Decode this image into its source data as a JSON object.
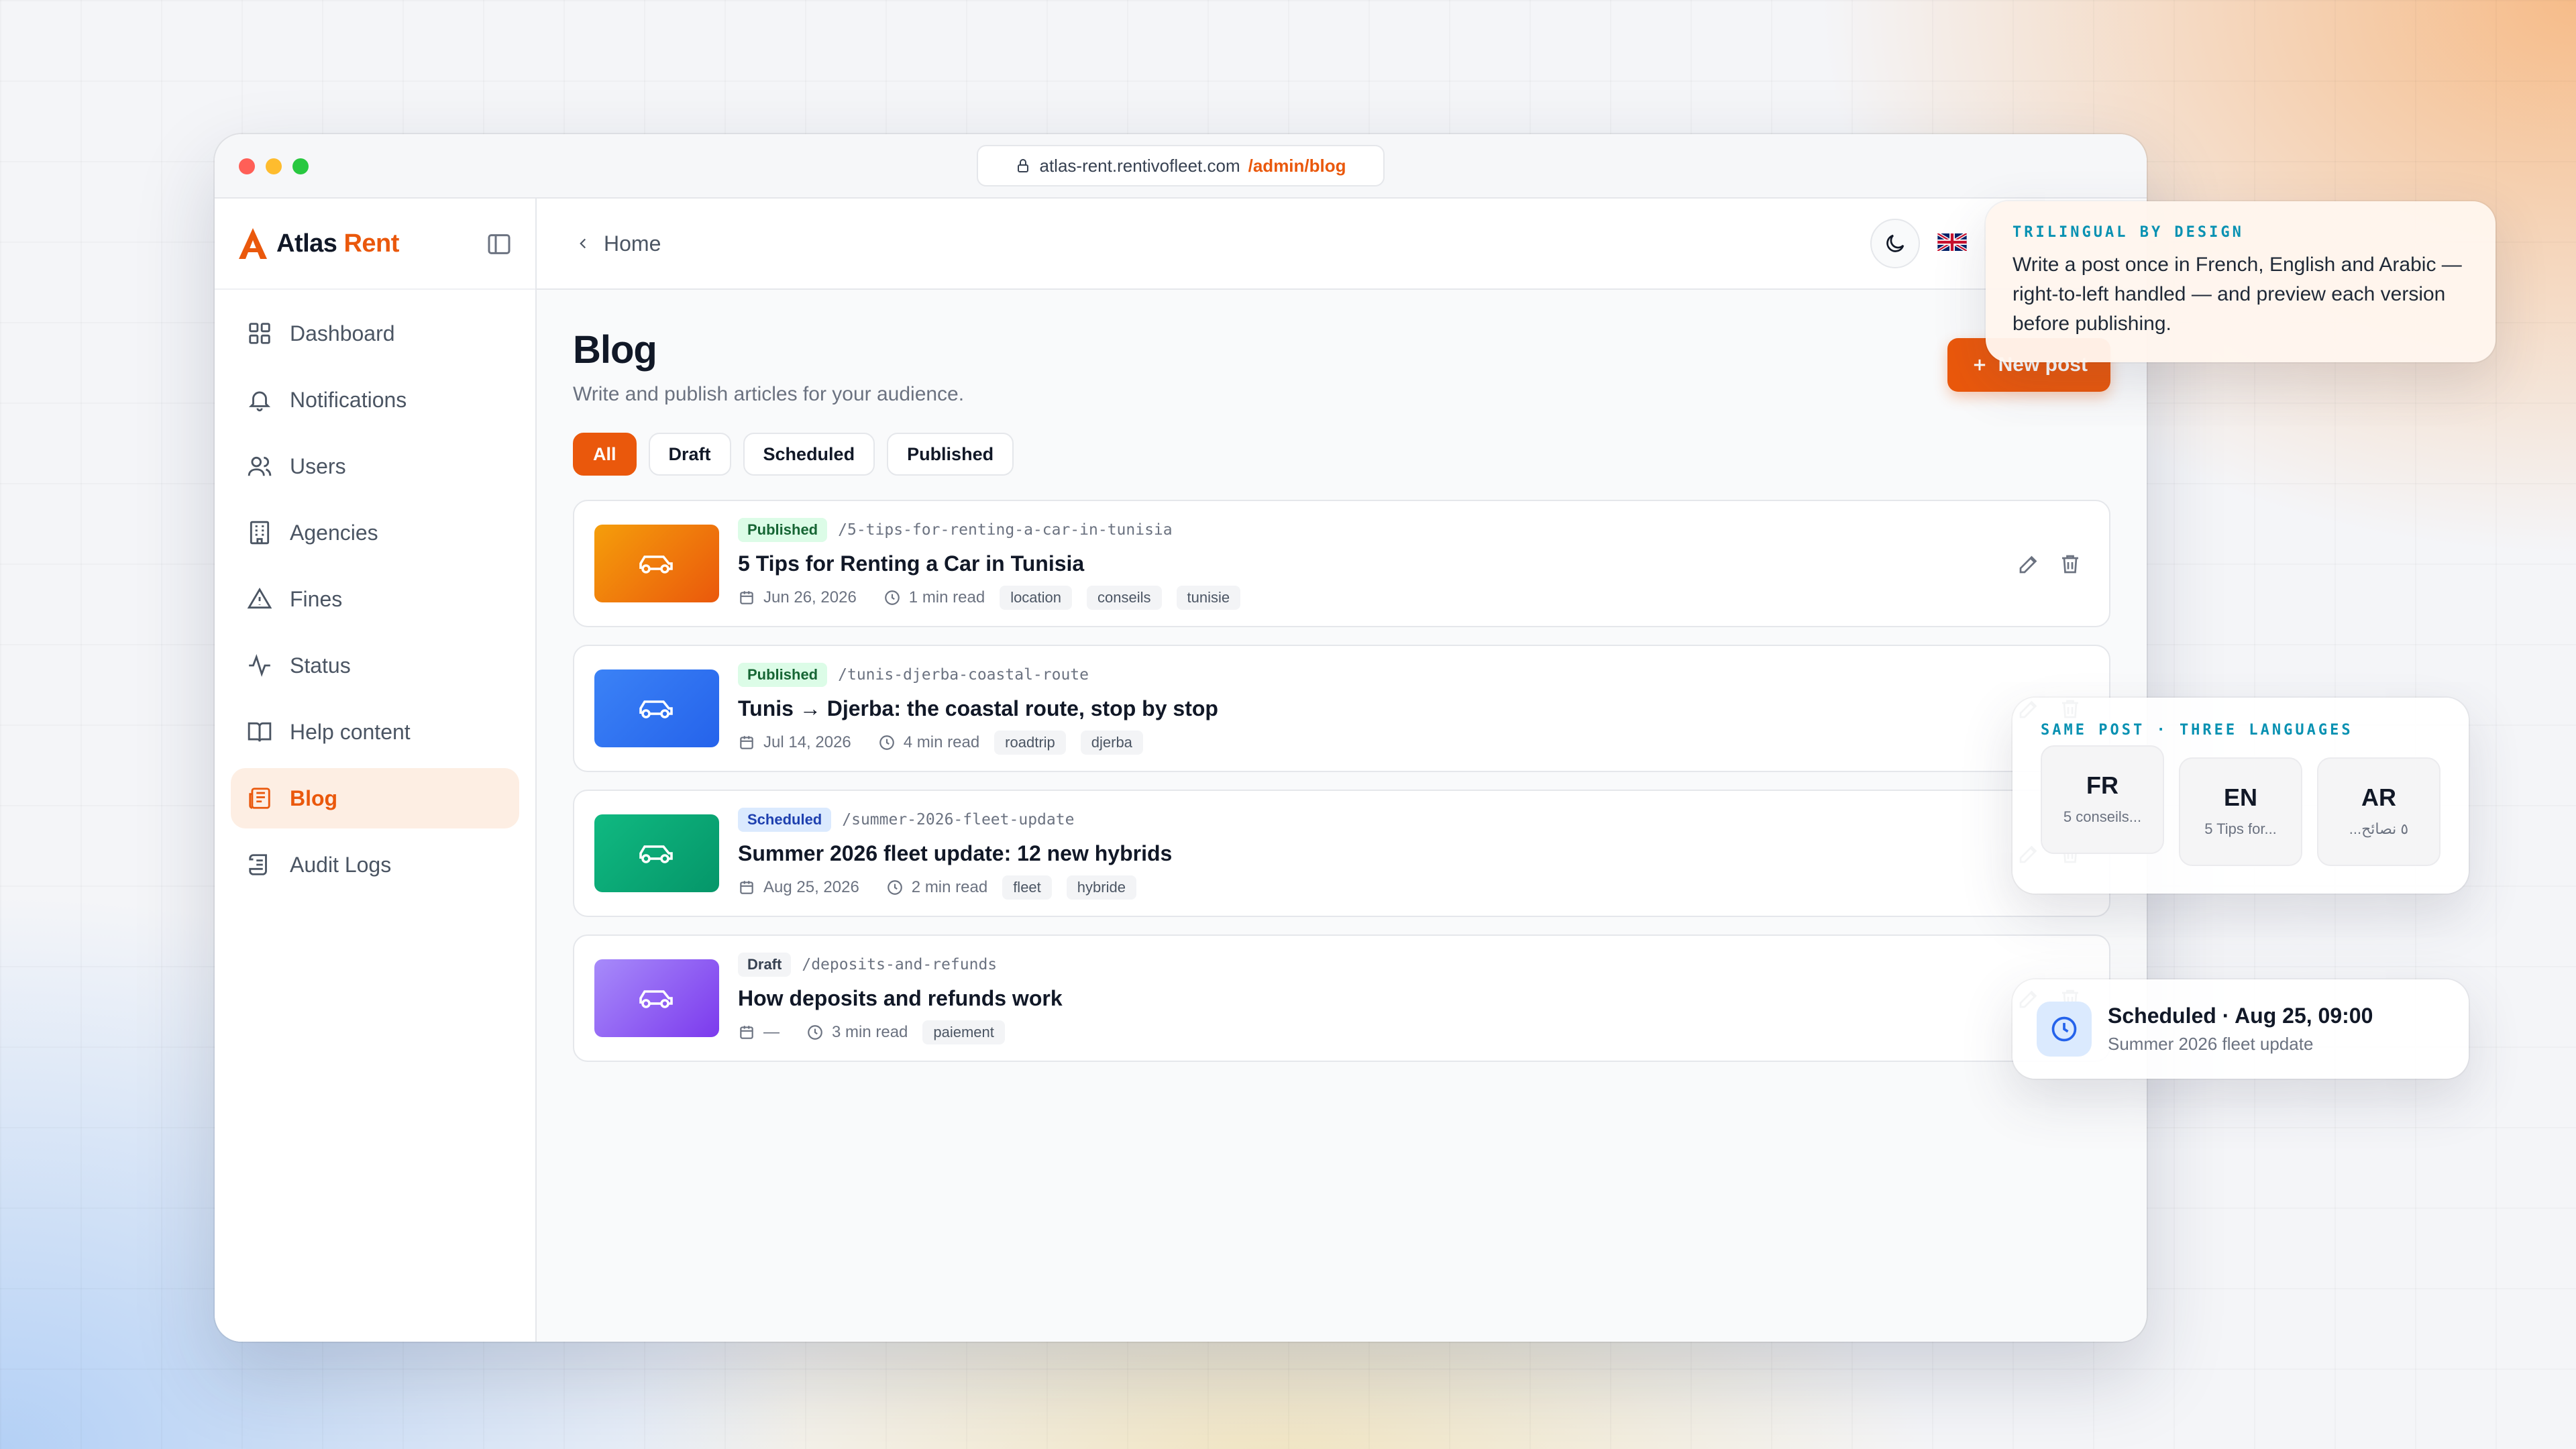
{
  "browser": {
    "url_host": "atlas-rent.rentivofleet.com",
    "url_path": "/admin/blog"
  },
  "brand": {
    "name_first": "Atlas",
    "name_second": "Rent",
    "accent": "#ea580c"
  },
  "sidebar": {
    "items": [
      {
        "label": "Dashboard",
        "icon": "grid-icon"
      },
      {
        "label": "Notifications",
        "icon": "bell-icon"
      },
      {
        "label": "Users",
        "icon": "users-icon"
      },
      {
        "label": "Agencies",
        "icon": "building-icon"
      },
      {
        "label": "Fines",
        "icon": "warning-icon"
      },
      {
        "label": "Status",
        "icon": "activity-icon"
      },
      {
        "label": "Help content",
        "icon": "book-icon"
      },
      {
        "label": "Blog",
        "icon": "newspaper-icon",
        "active": true
      },
      {
        "label": "Audit Logs",
        "icon": "scroll-icon"
      }
    ]
  },
  "topbar": {
    "breadcrumb": "Home"
  },
  "page": {
    "title": "Blog",
    "subtitle": "Write and publish articles for your audience.",
    "new_post_label": "New post",
    "filters": [
      "All",
      "Draft",
      "Scheduled",
      "Published"
    ],
    "active_filter": "All"
  },
  "posts": [
    {
      "status": "Published",
      "slug": "/5-tips-for-renting-a-car-in-tunisia",
      "title": "5 Tips for Renting a Car in Tunisia",
      "date": "Jun 26, 2026",
      "read_time": "1 min read",
      "tags": [
        "location",
        "conseils",
        "tunisie"
      ],
      "thumb_color": "#f97316"
    },
    {
      "status": "Published",
      "slug": "/tunis-djerba-coastal-route",
      "title": "Tunis → Djerba: the coastal route, stop by stop",
      "date": "Jul 14, 2026",
      "read_time": "4 min read",
      "tags": [
        "roadtrip",
        "djerba"
      ],
      "thumb_color": "#3b82f6"
    },
    {
      "status": "Scheduled",
      "slug": "/summer-2026-fleet-update",
      "title": "Summer 2026 fleet update: 12 new hybrids",
      "date": "Aug 25, 2026",
      "read_time": "2 min read",
      "tags": [
        "fleet",
        "hybride"
      ],
      "thumb_color": "#10b981"
    },
    {
      "status": "Draft",
      "slug": "/deposits-and-refunds",
      "title": "How deposits and refunds work",
      "date": "—",
      "read_time": "3 min read",
      "tags": [
        "paiement"
      ],
      "thumb_color": "#8b5cf6"
    }
  ],
  "callout_trilingual": {
    "eyebrow": "TRILINGUAL BY DESIGN",
    "body": "Write a post once in French, English and Arabic — right-to-left handled — and preview each version before publishing."
  },
  "callout_languages": {
    "eyebrow": "SAME POST · THREE LANGUAGES",
    "langs": [
      {
        "code": "FR",
        "snippet": "5 conseils..."
      },
      {
        "code": "EN",
        "snippet": "5 Tips for..."
      },
      {
        "code": "AR",
        "snippet": "٥ نصائح..."
      }
    ]
  },
  "callout_scheduled": {
    "title": "Scheduled · Aug 25, 09:00",
    "subtitle": "Summer 2026 fleet update"
  }
}
